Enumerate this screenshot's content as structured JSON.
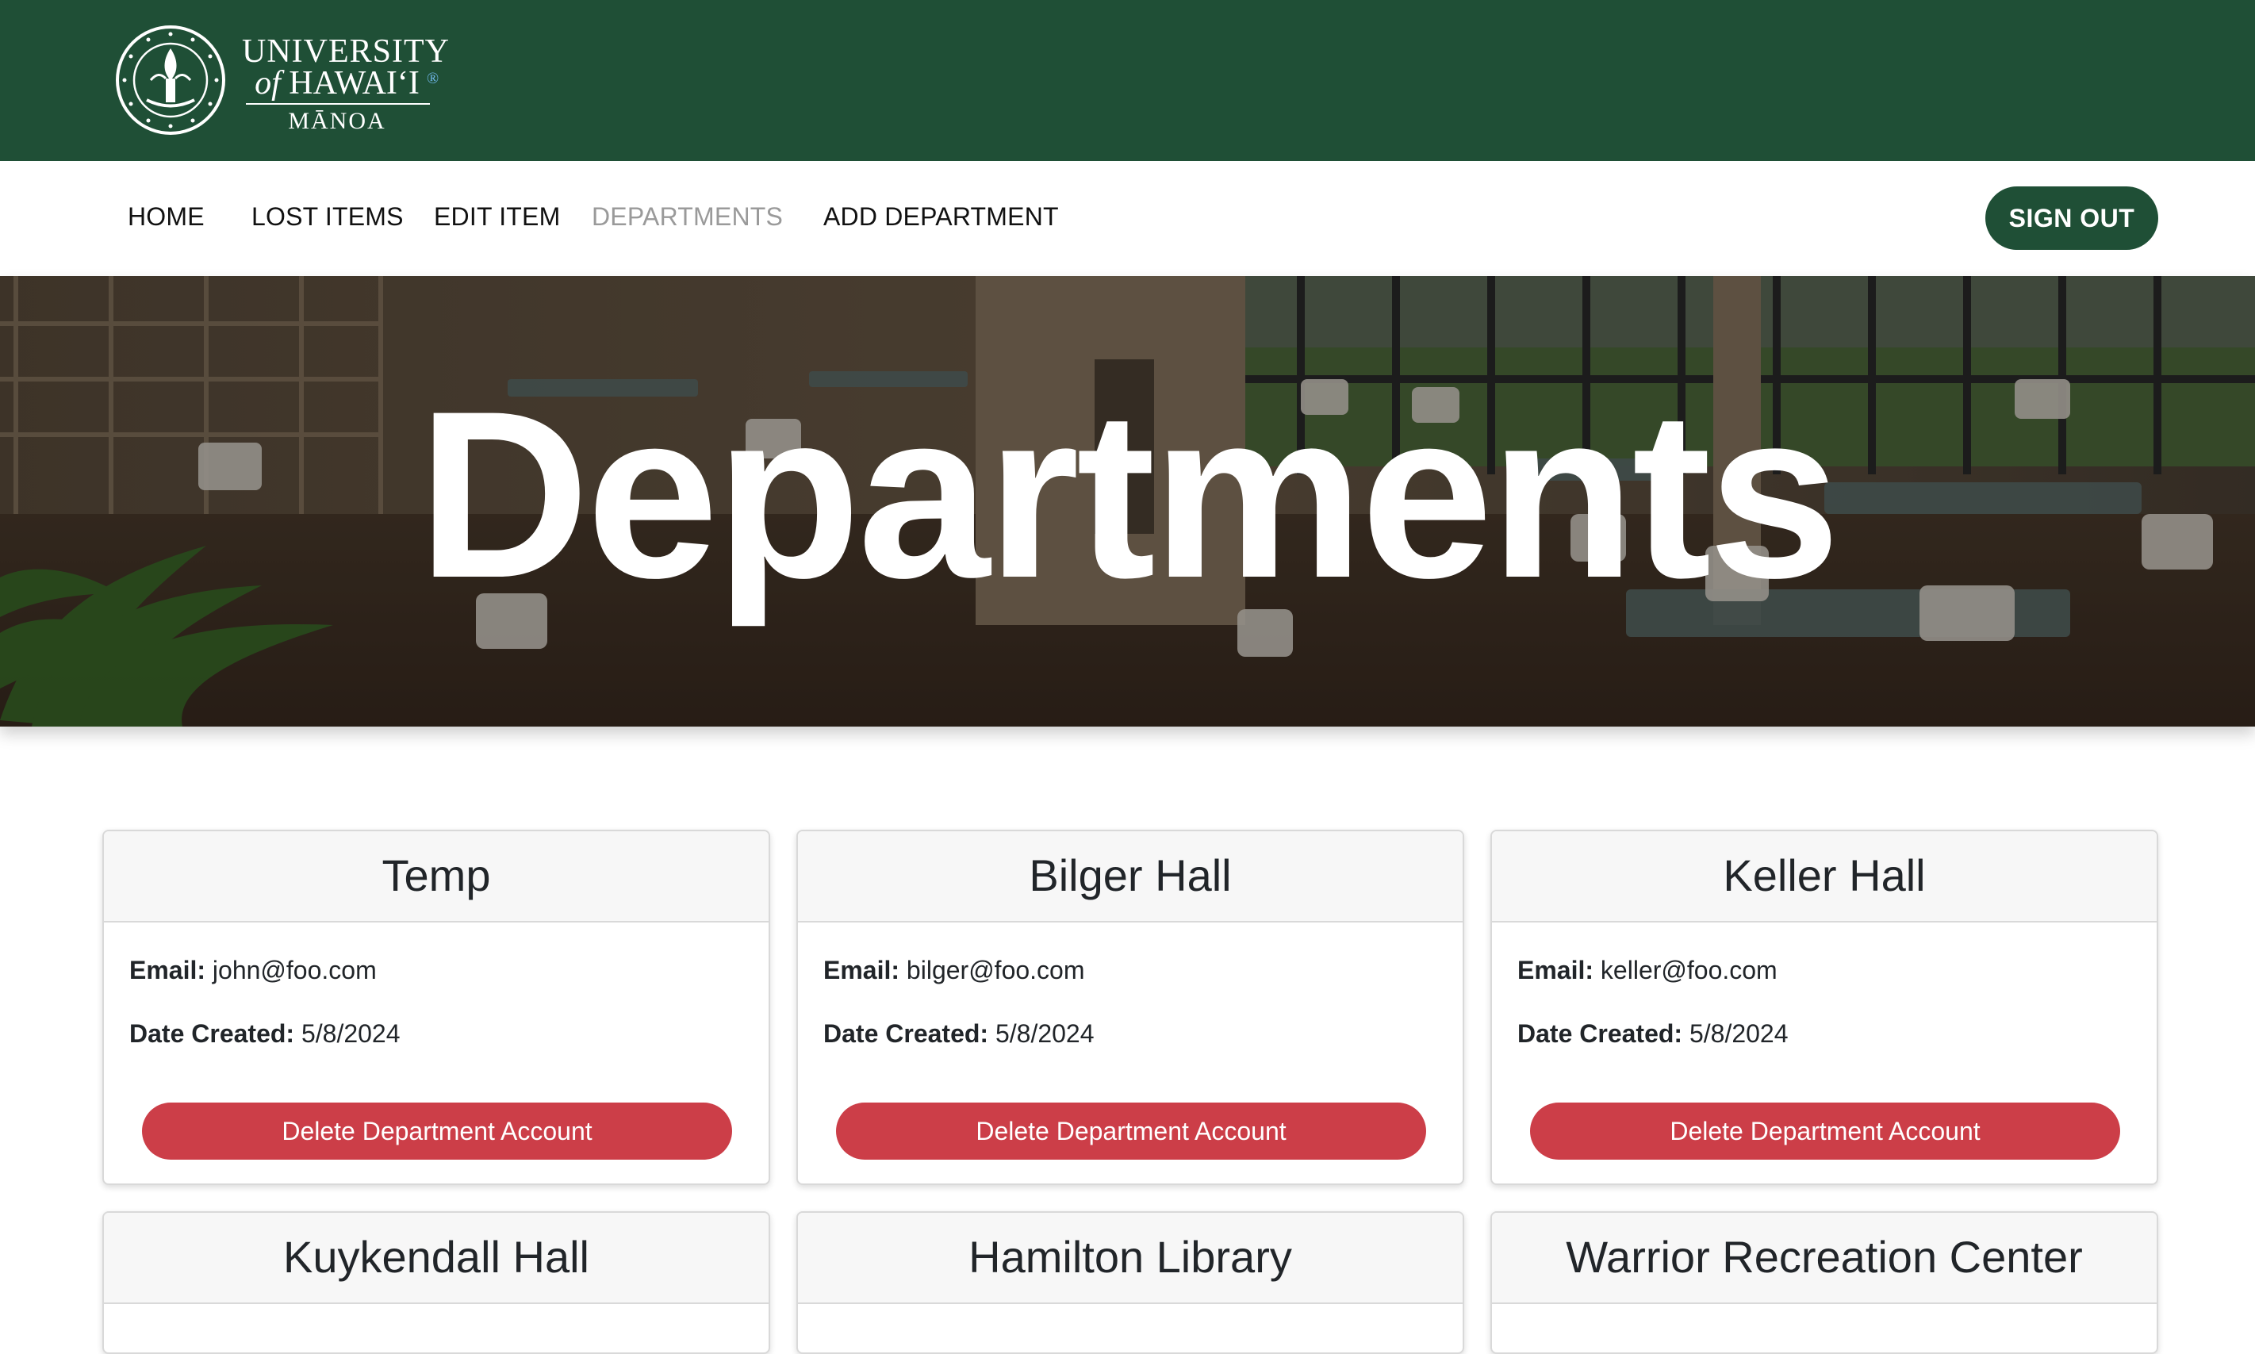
{
  "brand": {
    "wordmark_line1": "UNIVERSITY",
    "wordmark_of": "of",
    "wordmark_line2": "HAWAI‘I",
    "wordmark_reg": "®",
    "wordmark_line3": "MĀNOA",
    "seal_icon": "university-seal-icon",
    "banner_color": "#1f4f36"
  },
  "nav": {
    "home": "HOME",
    "lost_items": "LOST ITEMS",
    "edit_item": "EDIT ITEM",
    "departments": "DEPARTMENTS",
    "add_department": "ADD DEPARTMENT",
    "active": "DEPARTMENTS",
    "sign_out": "SIGN OUT"
  },
  "hero": {
    "title": "Departments"
  },
  "cards": [
    {
      "name": "Temp",
      "email_label": "Email:",
      "email": "john@foo.com",
      "date_label": "Date Created:",
      "date": "5/8/2024",
      "delete_label": "Delete Department Account"
    },
    {
      "name": "Bilger Hall",
      "email_label": "Email:",
      "email": "bilger@foo.com",
      "date_label": "Date Created:",
      "date": "5/8/2024",
      "delete_label": "Delete Department Account"
    },
    {
      "name": "Keller Hall",
      "email_label": "Email:",
      "email": "keller@foo.com",
      "date_label": "Date Created:",
      "date": "5/8/2024",
      "delete_label": "Delete Department Account"
    },
    {
      "name": "Kuykendall Hall"
    },
    {
      "name": "Hamilton Library"
    },
    {
      "name": "Warrior Recreation Center"
    }
  ],
  "colors": {
    "accent_green": "#1f4f36",
    "danger_red": "#cc3e48",
    "nav_active_gray": "#9a9a9a"
  }
}
